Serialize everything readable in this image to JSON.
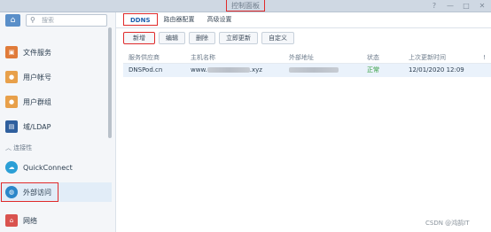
{
  "window": {
    "title": "控制面板",
    "buttons": [
      "?",
      "—",
      "□",
      "✕"
    ]
  },
  "sidebar": {
    "search_placeholder": "搜索",
    "items": [
      {
        "label": "文件服务",
        "icon": "file-services-icon",
        "color": "#e07b3a"
      },
      {
        "label": "用户帐号",
        "icon": "user-icon",
        "color": "#e8a04a"
      },
      {
        "label": "用户群组",
        "icon": "group-icon",
        "color": "#e8a04a"
      },
      {
        "label": "域/LDAP",
        "icon": "domain-icon",
        "color": "#2f5f9e"
      },
      {
        "label": "QuickConnect",
        "icon": "quickconnect-icon",
        "color": "#2b9fd6"
      },
      {
        "label": "外部访问",
        "icon": "external-access-icon",
        "color": "#2b86c9"
      },
      {
        "label": "网络",
        "icon": "network-icon",
        "color": "#d9534f"
      }
    ],
    "section_connectivity": "连接性"
  },
  "tabs": [
    "DDNS",
    "路由器配置",
    "高级设置"
  ],
  "toolbar": {
    "new": "新增",
    "edit": "编辑",
    "delete": "删除",
    "update_now": "立即更新",
    "customize": "自定义"
  },
  "table": {
    "headers": [
      "服务供应商",
      "主机名称",
      "外部地址",
      "状态",
      "上次更新时间",
      "!"
    ],
    "rows": [
      {
        "provider": "DNSPod.cn",
        "hostname_prefix": "www.",
        "hostname_suffix": ".xyz",
        "status": "正常",
        "last_update": "12/01/2020 12:09"
      }
    ]
  },
  "watermark": "CSDN @鸿鹄IT"
}
